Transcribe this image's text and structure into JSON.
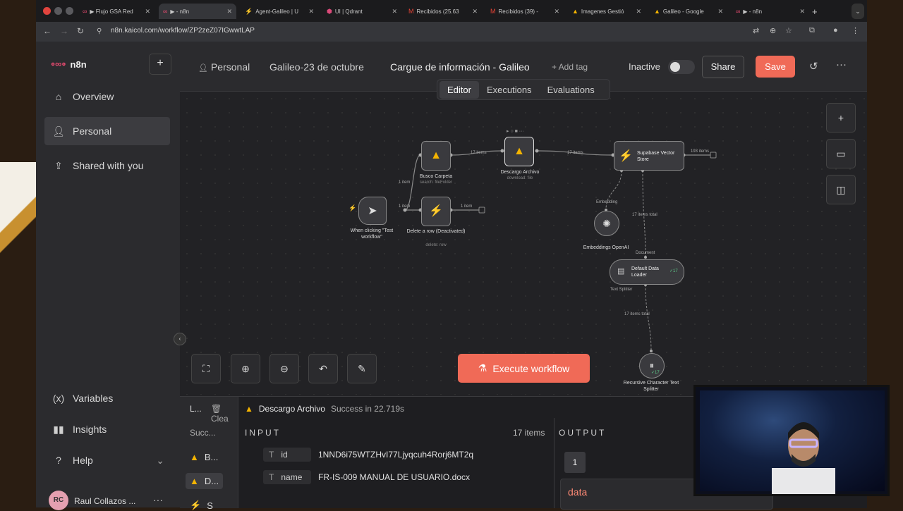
{
  "browser": {
    "tabs": [
      {
        "title": "▶ Flujo GSA Red",
        "active": false
      },
      {
        "title": "▶ - n8n",
        "active": true
      },
      {
        "title": "Agent-Galileo | U",
        "active": false
      },
      {
        "title": "UI | Qdrant",
        "active": false
      },
      {
        "title": "Recibidos (25.63",
        "active": false
      },
      {
        "title": "Recibidos (39) -",
        "active": false
      },
      {
        "title": "Imagenes Gestió",
        "active": false
      },
      {
        "title": "Galileo - Google",
        "active": false
      },
      {
        "title": "▶ - n8n",
        "active": false
      }
    ],
    "url": "n8n.kaicol.com/workflow/ZP2zeZ07IGwwtLAP"
  },
  "sidebar": {
    "logo_text": "n8n",
    "items": [
      {
        "label": "Overview",
        "icon": "home-icon"
      },
      {
        "label": "Personal",
        "icon": "user-icon"
      },
      {
        "label": "Shared with you",
        "icon": "share-icon"
      }
    ],
    "bottom_items": [
      {
        "label": "Variables",
        "icon": "variables-icon"
      },
      {
        "label": "Insights",
        "icon": "insights-icon"
      },
      {
        "label": "Help",
        "icon": "help-icon"
      }
    ],
    "user": {
      "initials": "RC",
      "name": "Raul Collazos ..."
    }
  },
  "header": {
    "crumb_personal": "Personal",
    "crumb_project": "Galileo-23 de octubre",
    "workflow_name": "Cargue de información - Galileo",
    "add_tag": "+ Add tag",
    "status": "Inactive",
    "share_label": "Share",
    "save_label": "Save"
  },
  "view_tabs": [
    "Editor",
    "Executions",
    "Evaluations"
  ],
  "workflow": {
    "nodes": {
      "trigger": {
        "label": "When clicking \"Test workflow\""
      },
      "busco": {
        "label": "Busco Carpeta",
        "sub": "search: fileFolder"
      },
      "descargo": {
        "label": "Descargo Archivo",
        "sub": "download: file"
      },
      "delete": {
        "label": "Delete a row (Deactivated)",
        "sub": "delete: row"
      },
      "supabase": {
        "label": "Supabase Vector Store"
      },
      "embeddings": {
        "label": "Embeddings OpenAI"
      },
      "loader": {
        "label": "Default Data Loader",
        "count": "17"
      },
      "splitter": {
        "label": "Recursive Character Text Splitter",
        "count": "17"
      }
    },
    "edge_labels": {
      "trigger_busco": "1 item",
      "trigger_delete": "1 item",
      "delete_out": "1 item",
      "busco_descargo": "17 items",
      "descargo_supabase": "17 items",
      "supabase_out": "193 items",
      "embedding_port": "Embedding",
      "document_port": "Document",
      "loader_total": "17 items total",
      "splitter_port": "Text Splitter",
      "splitter_total": "17 items total"
    },
    "execute_label": "Execute workflow"
  },
  "ndv": {
    "left_header": "L...",
    "clear_label": "Clea",
    "success_label": "Succ...",
    "left_items": [
      "B...",
      "D...",
      "S"
    ],
    "node_name": "Descargo Archivo",
    "status": "Success in 22.719s",
    "input_label": "INPUT",
    "items_count": "17 items",
    "output_label": "OUTPUT",
    "fields": [
      {
        "key": "id",
        "value": "1NND6i75WTZHvI77Ljyqcuh4Rorj6MT2q"
      },
      {
        "key": "name",
        "value": "FR-IS-009 MANUAL DE USUARIO.docx"
      }
    ],
    "page": "1",
    "data_label": "data"
  }
}
